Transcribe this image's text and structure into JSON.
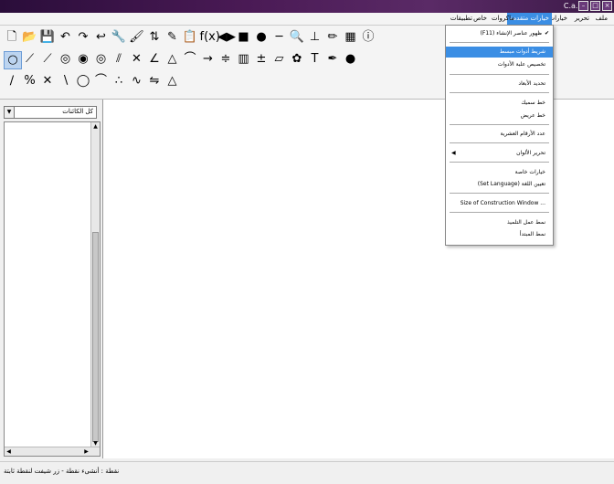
{
  "window": {
    "title": "C.a.R",
    "min": "–",
    "max": "□",
    "close": "×"
  },
  "menus": [
    {
      "label": "ملف"
    },
    {
      "label": "تحرير"
    },
    {
      "label": "خيارات"
    },
    {
      "label": "خيارات متقدمة"
    },
    {
      "label": "ماكروات"
    },
    {
      "label": "خاص"
    },
    {
      "label": "تطبيقات"
    }
  ],
  "toolbar": {
    "row1": [
      "new-file-icon",
      "open-file-icon",
      "save-file-icon",
      "undo-icon",
      "redo-icon",
      "back-icon",
      "wrench-icon",
      "paint-icon",
      "sort-icon",
      "edit-icon",
      "clipboard-icon",
      "function-icon",
      "arrows-icon",
      "black-square-icon",
      "dot-icon",
      "line-dash-icon",
      "zoom-icon",
      "axes-icon",
      "pencil-icon",
      "colors-icon",
      "info-icon"
    ],
    "row2": [
      "point-icon",
      "segment-icon",
      "line-icon",
      "circle-icon",
      "circle2-icon",
      "circle3-icon",
      "parallel-icon",
      "intersection-icon",
      "angle-icon",
      "triangle-icon",
      "polyline-icon",
      "ray-icon",
      "midpoint-icon",
      "grid-icon",
      "expression-icon",
      "polygon-icon",
      "gear-icon",
      "text-icon",
      "pen-icon",
      "gold-dot-icon"
    ],
    "row3": [
      "ratio-icon",
      "percent-icon",
      "cross-icon",
      "tangent-icon",
      "ellipse-icon",
      "curve-icon",
      "dotted-icon",
      "path-icon",
      "mirror-icon",
      "triangle-outline-icon"
    ]
  },
  "glyphs": {
    "row1": [
      "🗋",
      "📂",
      "💾",
      "↶",
      "↷",
      "↩",
      "🔧",
      "🖌",
      "⇅",
      "✎",
      "📋",
      "f(x)",
      "◀▶",
      "■",
      "●",
      "─",
      "🔍",
      "⊥",
      "✏",
      "▦",
      "ⓘ"
    ],
    "row2": [
      "○",
      "⟋",
      "⟋",
      "◎",
      "◉",
      "◎",
      "⫽",
      "✕",
      "∠",
      "△",
      "⌒",
      "→",
      "≑",
      "▥",
      "±",
      "▱",
      "✿",
      "T",
      "✒",
      "●"
    ],
    "row3": [
      "∕",
      "%",
      "✕",
      "∖",
      "◯",
      "⌒",
      "∴",
      "∿",
      "⇋",
      "△"
    ]
  },
  "sidebar": {
    "combo_label": "كل الكائنات",
    "combo_arrow": "▼"
  },
  "scroll": {
    "up": "▲",
    "down": "▼",
    "left": "◀",
    "right": "▶"
  },
  "dropdown": {
    "items": [
      {
        "label": "(F11) ظهور عناصر الإنشاء",
        "check": "✔"
      },
      {
        "label": "شريط أدوات مبسط",
        "highlight": true
      },
      {
        "label": "تخصيص علبة الأدوات"
      },
      {
        "label": "تحديد الأبعاد"
      },
      {
        "label": "خط سميك"
      },
      {
        "label": "خط عريض"
      },
      {
        "label": "عدد الأرقام العشرية"
      },
      {
        "label": "تحرير الألوان",
        "arrow": "◀"
      },
      {
        "label": "خيارات خاصة"
      },
      {
        "label": "(Set Language) تعيين اللغة"
      },
      {
        "label": "Size of Construction Window ..."
      },
      {
        "label": "نمط عمل التلميذ"
      },
      {
        "label": "نمط المبتدأ"
      }
    ]
  },
  "status": {
    "text": "نقطة : أنشىء نقطة - زر شيفت لنقطة ثابتة"
  },
  "colors": {
    "accent": "#3b8ee4",
    "title_bg": "#3c1a48"
  }
}
